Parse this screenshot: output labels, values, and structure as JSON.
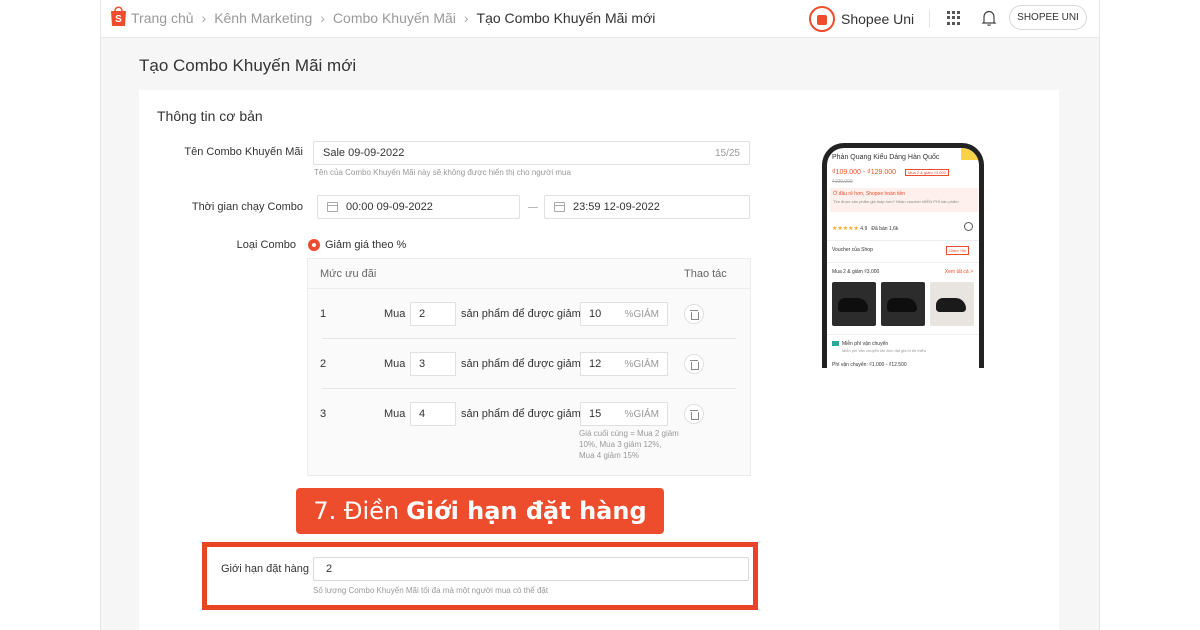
{
  "breadcrumb": {
    "items": [
      "Trang chủ",
      "Kênh Marketing",
      "Combo Khuyến Mãi"
    ],
    "current": "Tạo Combo Khuyến Mãi mới"
  },
  "header": {
    "brand_name": "Shopee Uni",
    "account_button": "SHOPEE UNI"
  },
  "page_title": "Tạo Combo Khuyến Mãi mới",
  "basic_info": {
    "section_title": "Thông tin cơ bản",
    "combo_name": {
      "label": "Tên Combo Khuyến Mãi",
      "value": "Sale 09-09-2022",
      "counter": "15/25",
      "hint": "Tên của Combo Khuyến Mãi này sẽ không được hiển thị cho người mua"
    },
    "run_time": {
      "label": "Thời gian chạy Combo",
      "start": "00:00 09-09-2022",
      "end": "23:59 12-09-2022"
    },
    "combo_type": {
      "label": "Loại Combo",
      "option": "Giảm giá theo %"
    }
  },
  "tiers": {
    "col_level": "Mức ưu đãi",
    "col_action": "Thao tác",
    "buy_label": "Mua",
    "mid_label": "sản phẩm để được giảm",
    "pct_suffix": "%GIẢM",
    "rows": [
      {
        "index": "1",
        "qty": "2",
        "discount": "10"
      },
      {
        "index": "2",
        "qty": "3",
        "discount": "12"
      },
      {
        "index": "3",
        "qty": "4",
        "discount": "15"
      }
    ],
    "final_note": "Giá cuối cùng = Mua 2 giảm 10%, Mua 3 giảm 12%, Mua 4 giảm 15%"
  },
  "callout": {
    "prefix": "7. Điền",
    "bold": "Giới hạn đặt hàng"
  },
  "order_limit": {
    "label": "Giới hạn đặt hàng",
    "value": "2",
    "hint": "Số lượng Combo Khuyến Mãi tối đa mà một người mua có thể đặt"
  },
  "phone_preview": {
    "title": "Phản Quang Kiểu Dáng Hàn Quốc",
    "price": "₫109.000 - ₫129.000",
    "tag": "Mua 2 & giảm ₫3.000",
    "old_price": "₫190.000",
    "promo_title": "Ở đâu rẻ hơn, Shopee hoàn tiền",
    "promo_text": "Tìm được sản phẩm giá thấp hơn? Nhận voucher MIỄN PHÍ sản phẩm",
    "stars": "★★★★★",
    "rating": "4.9",
    "sold": "Đã bán 1,6k",
    "voucher": "Voucher của Shop",
    "voucher_tag": "Giảm ₫5k",
    "combo": "Mua 2 & giảm ₫3.000",
    "see_all": "Xem tất cả >",
    "shipping": "Miễn phí vận chuyển",
    "shipping_sub": "Miễn phí vận chuyển khi đơn đạt giá trị tối thiểu",
    "shipping_fee": "Phí vận chuyển: ₫1.000 - ₫12.500"
  },
  "colors": {
    "accent": "#ee4d2d",
    "highlight_border": "#e84526"
  }
}
